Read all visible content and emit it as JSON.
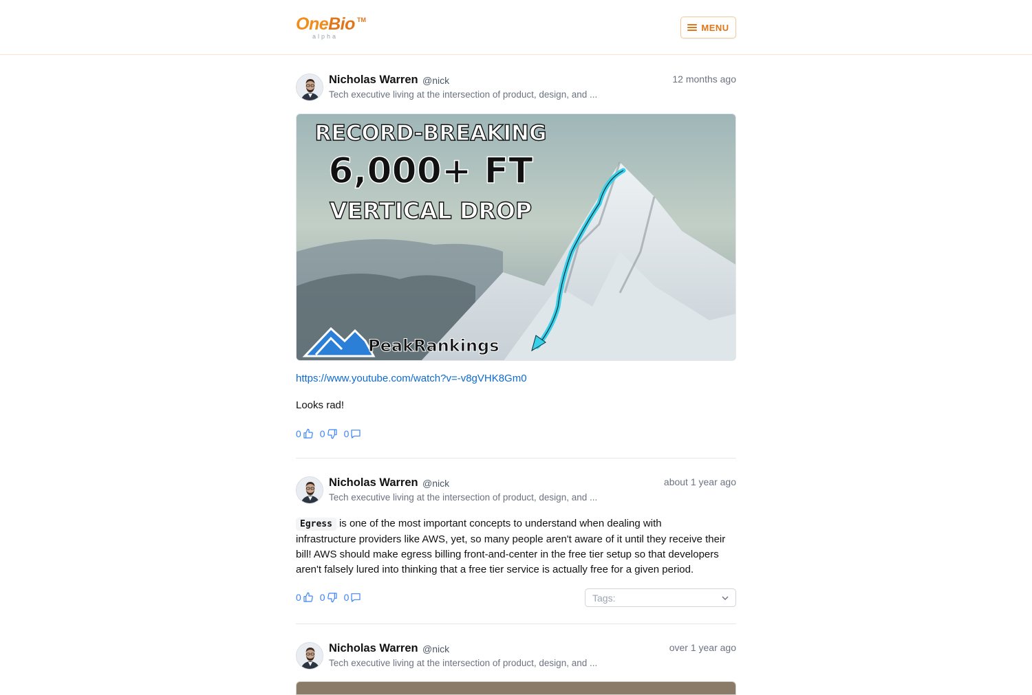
{
  "brand": {
    "name_part1": "One",
    "name_part2": "Bio",
    "trademark": "TM",
    "stage": "alpha"
  },
  "header": {
    "menu_label": "MENU"
  },
  "posts": [
    {
      "author": {
        "name": "Nicholas Warren",
        "handle": "@nick",
        "bio": "Tech executive living at the intersection of product, design, and ..."
      },
      "time": "12 months ago",
      "thumbnail": {
        "line1": "RECORD-BREAKING",
        "line2": "6,000+ FT",
        "line3": "VERTICAL DROP",
        "brand": "PeakRankings"
      },
      "link": "https://www.youtube.com/watch?v=-v8gVHK8Gm0",
      "text": "Looks rad!",
      "likes": "0",
      "dislikes": "0",
      "comments": "0"
    },
    {
      "author": {
        "name": "Nicholas Warren",
        "handle": "@nick",
        "bio": "Tech executive living at the intersection of product, design, and ..."
      },
      "time": "about 1 year ago",
      "code": "Egress",
      "text_lines": [
        "is one of the most important concepts to understand when dealing with",
        "infrastructure providers like AWS, yet, so many people aren't aware of it until they receive their",
        "bill! AWS should make egress billing front-and-center in the free tier setup so that developers",
        "aren't falsely lured into thinking that a free tier service is actually free for a given period."
      ],
      "likes": "0",
      "dislikes": "0",
      "comments": "0",
      "tags_placeholder": "Tags:"
    },
    {
      "author": {
        "name": "Nicholas Warren",
        "handle": "@nick",
        "bio": "Tech executive living at the intersection of product, design, and ..."
      },
      "time": "over 1 year ago"
    }
  ],
  "colors": {
    "accent": "#e0751a",
    "link": "#0b6bd3",
    "action": "#3b82f6"
  },
  "icons": {
    "menu": "hamburger-icon",
    "like": "thumbs-up-icon",
    "dislike": "thumbs-down-icon",
    "comment": "comment-icon"
  }
}
